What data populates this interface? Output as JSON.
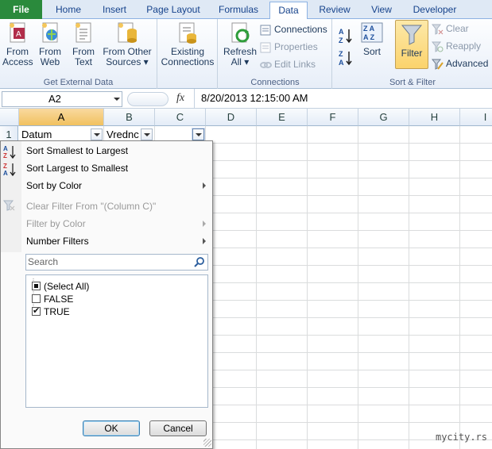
{
  "tabs": {
    "file": "File",
    "home": "Home",
    "insert": "Insert",
    "page_layout": "Page Layout",
    "formulas": "Formulas",
    "data": "Data",
    "review": "Review",
    "view": "View",
    "developer": "Developer"
  },
  "ribbon": {
    "from_access": [
      "From",
      "Access"
    ],
    "from_web": [
      "From",
      "Web"
    ],
    "from_text": [
      "From",
      "Text"
    ],
    "from_other": [
      "From Other",
      "Sources ▾"
    ],
    "existing": [
      "Existing",
      "Connections"
    ],
    "get_external_label": "Get External Data",
    "refresh": [
      "Refresh",
      "All ▾"
    ],
    "connections": "Connections",
    "properties": "Properties",
    "edit_links": "Edit Links",
    "connections_group_label": "Connections",
    "sort": "Sort",
    "filter": "Filter",
    "clear": "Clear",
    "reapply": "Reapply",
    "advanced": "Advanced",
    "sort_filter_label": "Sort & Filter"
  },
  "formula_bar": {
    "name_box": "A2",
    "fx": "fx",
    "formula": "8/20/2013  12:15:00 AM"
  },
  "grid": {
    "columns": [
      "A",
      "B",
      "C",
      "D",
      "E",
      "F",
      "G",
      "H",
      "I"
    ],
    "row1": "1",
    "cell_a1": "Datum",
    "cell_b1": "Vrednc"
  },
  "menu": {
    "sort_asc": "Sort Smallest to Largest",
    "sort_desc": "Sort Largest to Smallest",
    "sort_color": "Sort by Color",
    "clear_filter": "Clear Filter From \"(Column C)\"",
    "filter_color": "Filter by Color",
    "number_filters": "Number Filters",
    "search_placeholder": "Search",
    "items": [
      {
        "label": "(Select All)",
        "state": "partial"
      },
      {
        "label": "FALSE",
        "state": "unchecked"
      },
      {
        "label": "TRUE",
        "state": "checked"
      }
    ],
    "ok": "OK",
    "cancel": "Cancel"
  },
  "watermark": "mycity.rs",
  "colors": {
    "file_tab": "#2a8a3c",
    "selected_header": "#f1c15f",
    "filter_active": "#fbd36c"
  }
}
